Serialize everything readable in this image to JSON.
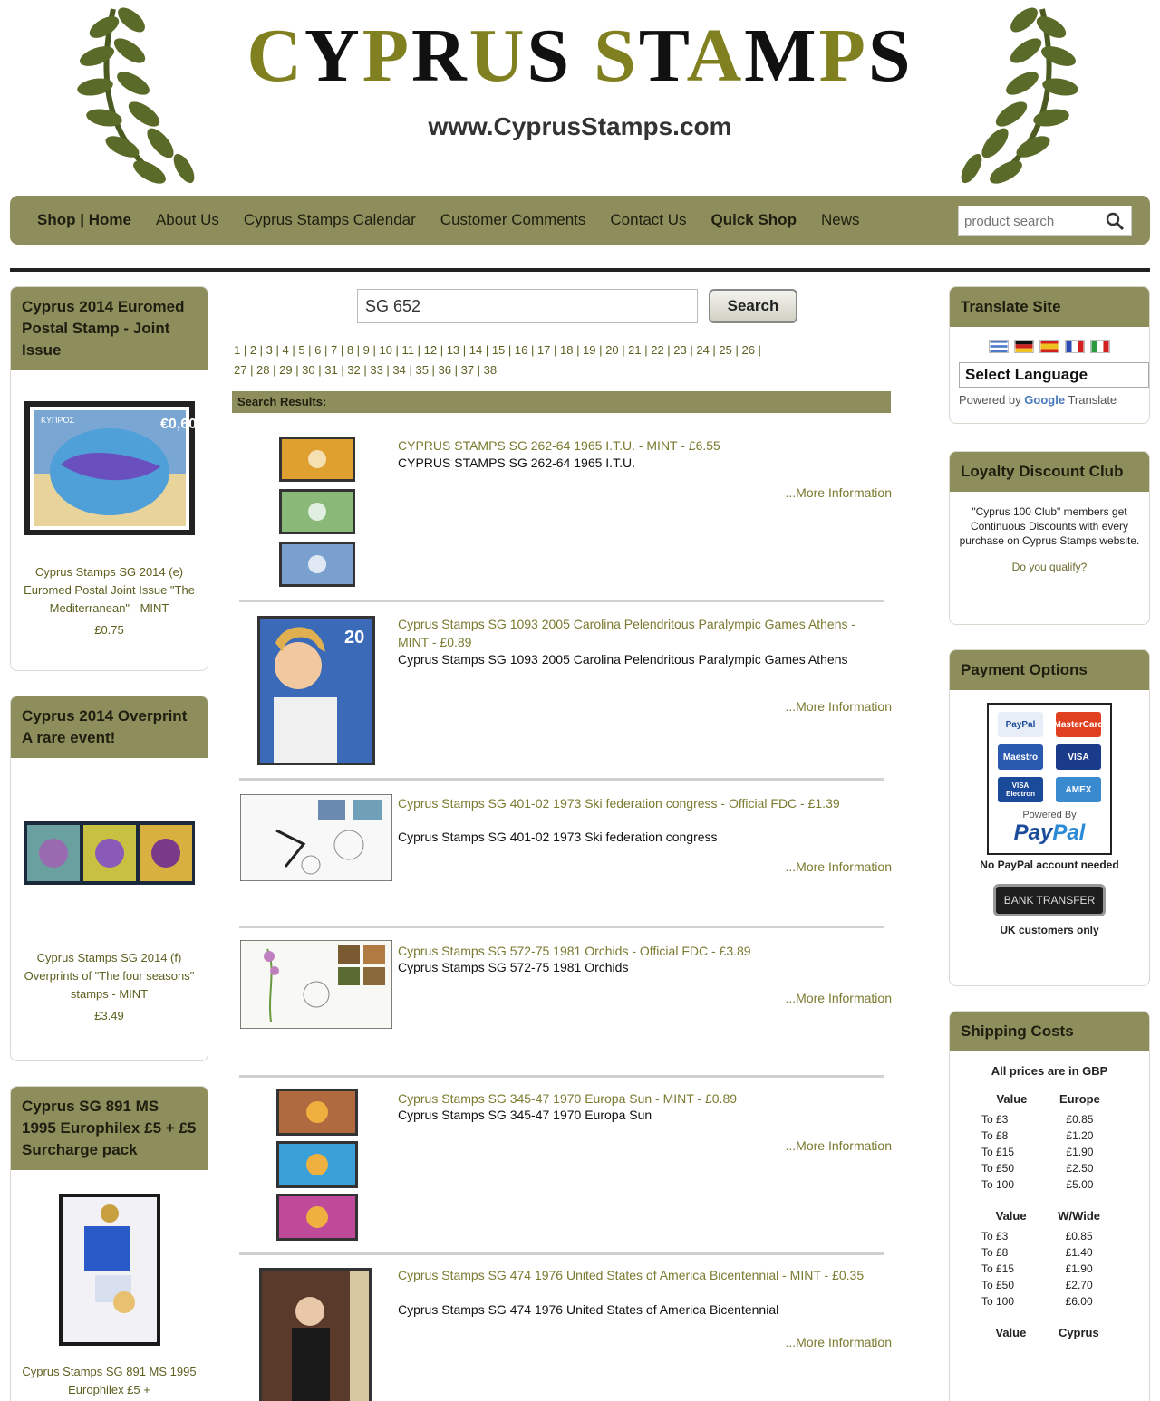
{
  "header": {
    "logo_title": "CYPRUS STAMPS",
    "logo_url": "www.CyprusStamps.com"
  },
  "nav": {
    "items": [
      "Shop | Home",
      "About Us",
      "Cyprus Stamps Calendar",
      "Customer Comments",
      "Contact Us",
      "Quick Shop",
      "News"
    ],
    "search_placeholder": "product search"
  },
  "left": {
    "boxes": [
      {
        "title": "Cyprus 2014 Euromed Postal Stamp - Joint Issue",
        "caption": "Cyprus Stamps SG 2014 (e) Euromed Postal Joint Issue \"The Mediterranean\" - MINT",
        "price": "£0.75"
      },
      {
        "title": "Cyprus 2014 Overprint A rare event!",
        "caption": "Cyprus Stamps SG 2014 (f) Overprints of \"The four seasons\" stamps - MINT",
        "price": "£3.49"
      },
      {
        "title": "Cyprus SG 891 MS 1995 Europhilex £5 + £5 Surcharge pack",
        "caption": "Cyprus Stamps SG 891 MS 1995 Europhilex £5 +",
        "price": ""
      }
    ]
  },
  "center": {
    "search_value": "SG 652",
    "search_button": "Search",
    "pager_line1": "1 | 2 | 3 | 4 | 5 | 6 | 7 | 8 | 9 | 10 | 11 | 12 | 13 | 14 | 15 | 16 | 17 | 18 | 19 | 20 | 21 | 22 | 23 | 24 | 25 | 26 |",
    "pager_line2": "27 | 28 | 29 | 30 | 31 | 32 | 33 | 34 | 35 | 36 | 37 | 38",
    "results_header": "Search Results:",
    "more_label": "...More Information",
    "results": [
      {
        "title": "CYPRUS STAMPS SG 262-64 1965 I.T.U. - MINT - £6.55",
        "desc": "CYPRUS STAMPS SG 262-64 1965 I.T.U."
      },
      {
        "title": "Cyprus Stamps SG 1093 2005 Carolina Pelendritous Paralympic Games Athens - MINT - £0.89",
        "desc": "Cyprus Stamps SG 1093 2005 Carolina Pelendritous Paralympic Games Athens"
      },
      {
        "title": "Cyprus Stamps SG 401-02 1973 Ski federation congress - Official FDC - £1.39",
        "desc": "Cyprus Stamps SG 401-02 1973 Ski federation congress"
      },
      {
        "title": "Cyprus Stamps SG 572-75 1981 Orchids - Official FDC - £3.89",
        "desc": "Cyprus Stamps SG 572-75 1981 Orchids"
      },
      {
        "title": "Cyprus Stamps SG 345-47 1970 Europa Sun - MINT - £0.89",
        "desc": "Cyprus Stamps SG 345-47 1970 Europa Sun"
      },
      {
        "title": "Cyprus Stamps SG 474 1976 United States of America Bicentennial - MINT - £0.35",
        "desc": "Cyprus Stamps SG 474 1976 United States of America Bicentennial"
      }
    ]
  },
  "right": {
    "translate": {
      "title": "Translate Site",
      "select": "Select Language",
      "powered_prefix": "Powered by",
      "powered_google": "Google",
      "powered_suffix": "Translate"
    },
    "loyalty": {
      "title": "Loyalty Discount Club",
      "text": "\"Cyprus 100 Club\" members get Continuous Discounts with every purchase on Cyprus Stamps website.",
      "link": "Do you qualify?"
    },
    "payment": {
      "title": "Payment Options",
      "cards": [
        "PayPal",
        "MasterCard",
        "Maestro",
        "VISA",
        "VISA Electron",
        "AMEX"
      ],
      "powered_by": "Powered By",
      "paypal_a": "Pay",
      "paypal_b": "Pal",
      "note": "No PayPal account needed",
      "bank_button": "BANK TRANSFER",
      "bank_note": "UK customers only"
    },
    "shipping": {
      "title": "Shipping Costs",
      "note": "All prices are in GBP",
      "europe": {
        "headers": [
          "Value",
          "Europe"
        ],
        "rows": [
          [
            "To £3",
            "£0.85"
          ],
          [
            "To £8",
            "£1.20"
          ],
          [
            "To £15",
            "£1.90"
          ],
          [
            "To £50",
            "£2.50"
          ],
          [
            "To 100",
            "£5.00"
          ]
        ]
      },
      "world": {
        "headers": [
          "Value",
          "W/Wide"
        ],
        "rows": [
          [
            "To £3",
            "£0.85"
          ],
          [
            "To £8",
            "£1.40"
          ],
          [
            "To £15",
            "£1.90"
          ],
          [
            "To £50",
            "£2.70"
          ],
          [
            "To 100",
            "£6.00"
          ]
        ]
      },
      "cyprus": {
        "headers": [
          "Value",
          "Cyprus"
        ]
      }
    }
  },
  "colors": {
    "accent": "#8e8e5c",
    "logo_olive": "#808020",
    "link": "#7a7a30"
  }
}
